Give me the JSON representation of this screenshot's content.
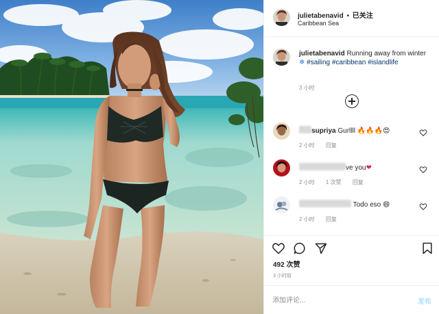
{
  "post": {
    "username": "julietabenavid",
    "follow_separator": "•",
    "follow_label": "已关注",
    "location": "Caribbean Sea"
  },
  "caption": {
    "username": "julietabenavid",
    "text_before": "Running away from winter",
    "emoji": "❄",
    "hashtags": [
      "#sailing",
      "#caribbean",
      "#islandlife"
    ],
    "time": "3 小时"
  },
  "comments": [
    {
      "name_visible": "supriya",
      "text": "Gurllll",
      "emojis": "🔥🔥🔥😍",
      "time": "2 小时",
      "reply": "回复",
      "likes": ""
    },
    {
      "name_visible": "",
      "text": "ve you",
      "emojis": "❤",
      "time": "2 小时",
      "likes": "1 次赞",
      "reply": "回复"
    },
    {
      "name_visible": "",
      "text": "Todo eso",
      "emojis": "😄",
      "time": "2 小时",
      "reply": "回复",
      "likes": ""
    }
  ],
  "likes": "492 次赞",
  "post_time": "3 小时前",
  "comment_input": {
    "placeholder": "添加评论...",
    "value": ""
  },
  "publish_label": "发布",
  "icons": {
    "like": "heart-icon",
    "comment": "comment-bubble-icon",
    "share": "paper-plane-icon",
    "save": "bookmark-icon",
    "load_more": "plus-circle-icon"
  },
  "colors": {
    "hashtag": "#00376b",
    "publish_disabled": "#b2dffc",
    "secondary_text": "#8e8e8e",
    "divider": "#efefef"
  }
}
